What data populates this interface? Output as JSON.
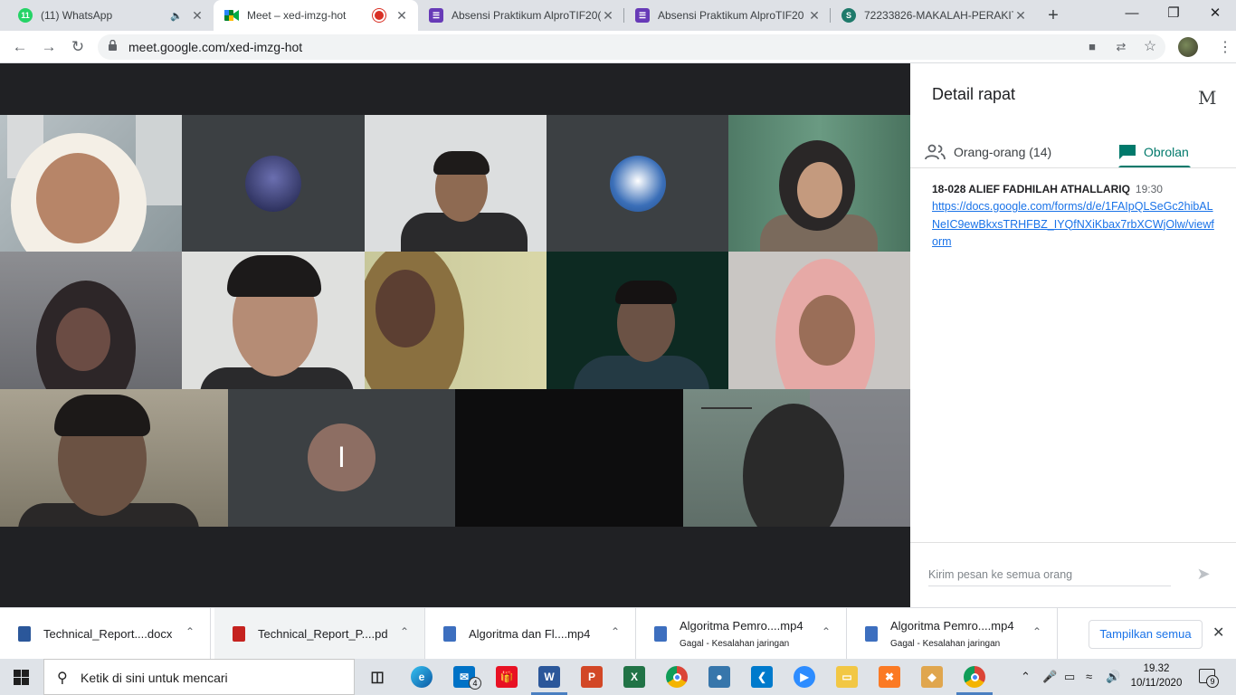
{
  "browser": {
    "tabs": [
      {
        "title": "(11) WhatsApp",
        "badge": "11"
      },
      {
        "title": "Meet – xed-imzg-hot"
      },
      {
        "title": "Absensi Praktikum AlproTIF20("
      },
      {
        "title": "Absensi Praktikum AlproTIF20"
      },
      {
        "title": "72233826-MAKALAH-PERAKIT"
      }
    ],
    "url": "meet.google.com/xed-imzg-hot"
  },
  "meet": {
    "tiles": {
      "initial_avatar": "I"
    }
  },
  "panel": {
    "title": "Detail rapat",
    "account_initial": "M",
    "tab_people": "Orang-orang (14)",
    "tab_chat": "Obrolan",
    "message": {
      "sender": "18-028 ALIEF FADHILAH ATHALLARIQ",
      "time": "19:30",
      "link": "https://docs.google.com/forms/d/e/1FAIpQLSeGc2hibALNeIC9ewBkxsTRHFBZ_IYQfNXiKbax7rbXCWjOlw/viewform"
    },
    "input_placeholder": "Kirim pesan ke semua orang"
  },
  "downloads": {
    "items": [
      {
        "name": "Technical_Report....docx",
        "status": ""
      },
      {
        "name": "Technical_Report_P....pd",
        "status": ""
      },
      {
        "name": "Algoritma dan Fl....mp4",
        "status": ""
      },
      {
        "name": "Algoritma Pemro....mp4",
        "status": "Gagal - Kesalahan jaringan"
      },
      {
        "name": "Algoritma Pemro....mp4",
        "status": "Gagal - Kesalahan jaringan"
      }
    ],
    "show_all": "Tampilkan semua"
  },
  "taskbar": {
    "search_placeholder": "Ketik di sini untuk mencari",
    "mail_badge": "4",
    "time": "19.32",
    "date": "10/11/2020",
    "notification_count": "9"
  }
}
